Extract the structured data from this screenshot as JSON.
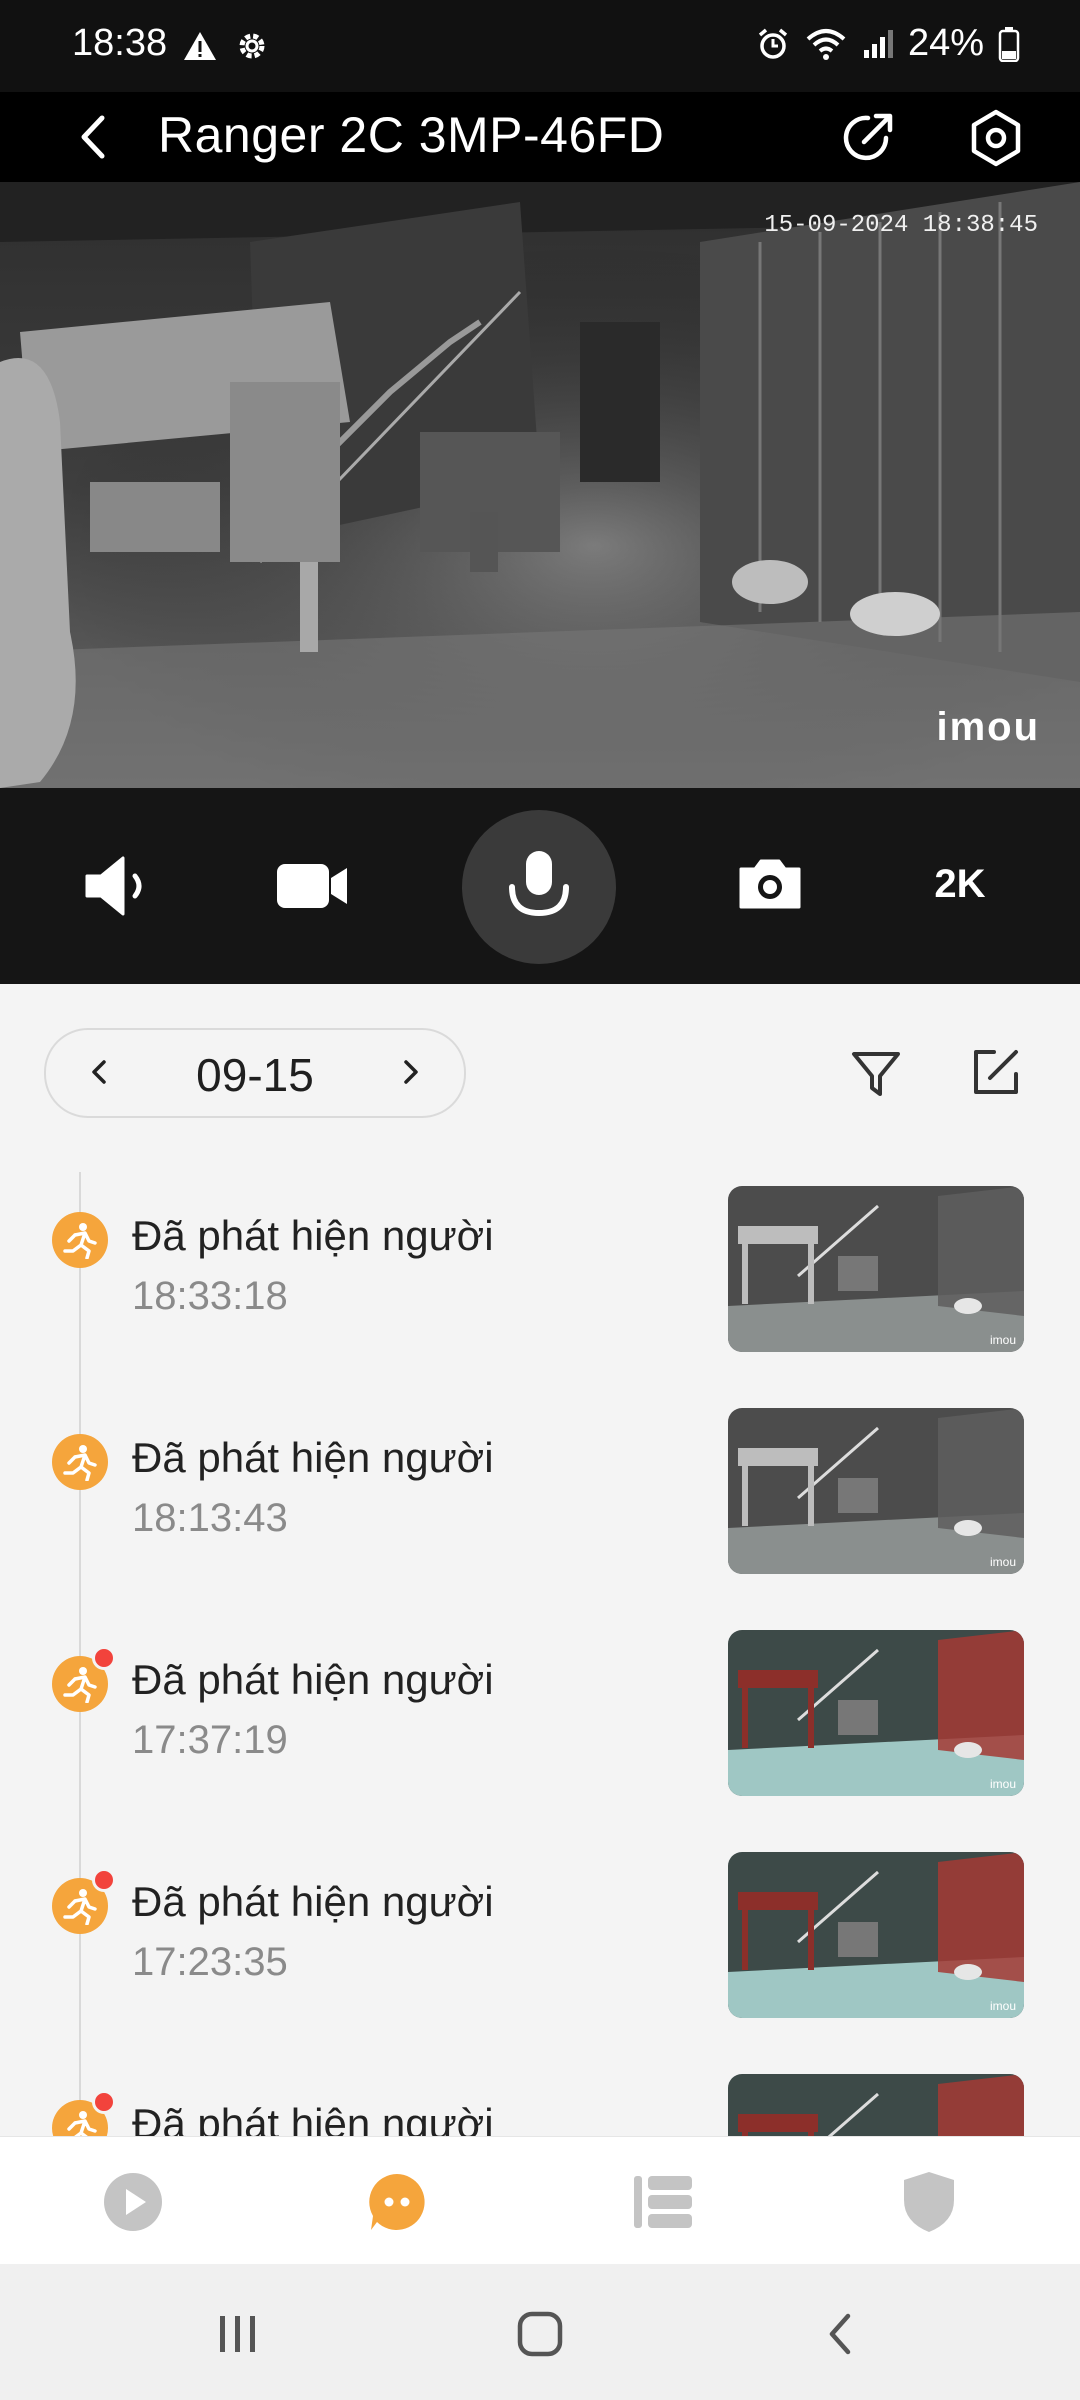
{
  "status_bar": {
    "time": "18:38",
    "battery": "24%",
    "icons": [
      "warning-icon",
      "gear-icon",
      "alarm-icon",
      "wifi-icon",
      "signal-icon",
      "battery-icon"
    ]
  },
  "app_bar": {
    "title": "Ranger 2C 3MP-46FD",
    "icons": [
      "back-arrow-icon",
      "share-icon",
      "settings-icon"
    ]
  },
  "video": {
    "timestamp": "15-09-2024 18:38:45",
    "brand": "imou"
  },
  "controls": {
    "quality": "2K",
    "icons": [
      "speaker-icon",
      "video-record-icon",
      "microphone-icon",
      "camera-icon"
    ]
  },
  "date_selector": {
    "date": "09-15"
  },
  "events": [
    {
      "title": "Đã phát hiện người",
      "time": "18:33:18",
      "unread": false,
      "thumb": "night"
    },
    {
      "title": "Đã phát hiện người",
      "time": "18:13:43",
      "unread": false,
      "thumb": "night"
    },
    {
      "title": "Đã phát hiện người",
      "time": "17:37:19",
      "unread": true,
      "thumb": "color"
    },
    {
      "title": "Đã phát hiện người",
      "time": "17:23:35",
      "unread": true,
      "thumb": "color"
    },
    {
      "title": "Đã phát hiện người",
      "time": "",
      "unread": true,
      "thumb": "color"
    }
  ],
  "bottom_nav": {
    "items": [
      "playback-icon",
      "messages-icon",
      "list-icon",
      "shield-icon"
    ],
    "active_index": 1
  },
  "colors": {
    "accent": "#f5a53c",
    "unread_dot": "#f2433c",
    "header_bg": "#000000",
    "controls_bg": "#151515"
  }
}
